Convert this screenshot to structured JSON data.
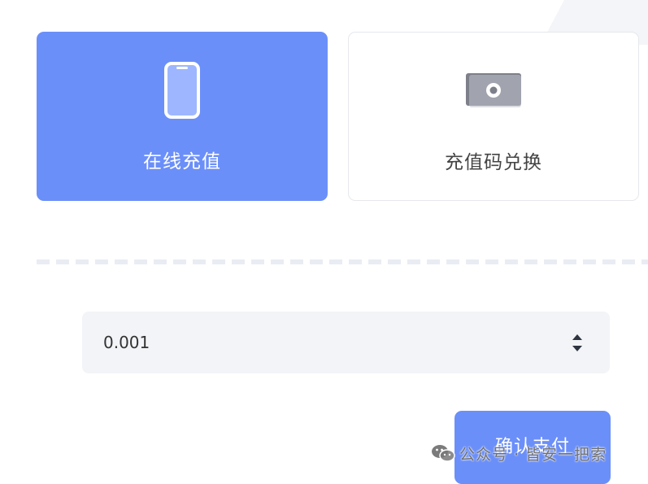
{
  "cards": [
    {
      "label": "在线充值",
      "icon": "phone-icon",
      "selected": true
    },
    {
      "label": "充值码兑换",
      "icon": "cash-icon",
      "selected": false
    }
  ],
  "amount": {
    "value": "0.001"
  },
  "pay_button": {
    "label": "确认支付"
  },
  "watermark": {
    "text": "公众号 · 皆安一把索"
  },
  "colors": {
    "accent": "#6b8ff9",
    "input_bg": "#f2f4f7",
    "divider": "#e9ecf3"
  }
}
